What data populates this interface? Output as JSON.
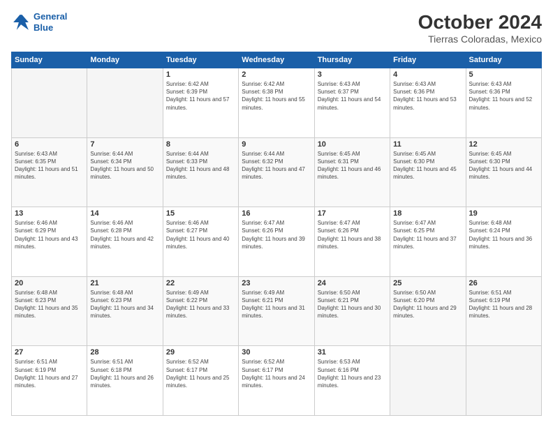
{
  "logo": {
    "line1": "General",
    "line2": "Blue"
  },
  "title": "October 2024",
  "subtitle": "Tierras Coloradas, Mexico",
  "headers": [
    "Sunday",
    "Monday",
    "Tuesday",
    "Wednesday",
    "Thursday",
    "Friday",
    "Saturday"
  ],
  "weeks": [
    [
      {
        "day": "",
        "empty": true
      },
      {
        "day": "",
        "empty": true
      },
      {
        "day": "1",
        "sunrise": "6:42 AM",
        "sunset": "6:39 PM",
        "daylight": "11 hours and 57 minutes."
      },
      {
        "day": "2",
        "sunrise": "6:42 AM",
        "sunset": "6:38 PM",
        "daylight": "11 hours and 55 minutes."
      },
      {
        "day": "3",
        "sunrise": "6:43 AM",
        "sunset": "6:37 PM",
        "daylight": "11 hours and 54 minutes."
      },
      {
        "day": "4",
        "sunrise": "6:43 AM",
        "sunset": "6:36 PM",
        "daylight": "11 hours and 53 minutes."
      },
      {
        "day": "5",
        "sunrise": "6:43 AM",
        "sunset": "6:36 PM",
        "daylight": "11 hours and 52 minutes."
      }
    ],
    [
      {
        "day": "6",
        "sunrise": "6:43 AM",
        "sunset": "6:35 PM",
        "daylight": "11 hours and 51 minutes."
      },
      {
        "day": "7",
        "sunrise": "6:44 AM",
        "sunset": "6:34 PM",
        "daylight": "11 hours and 50 minutes."
      },
      {
        "day": "8",
        "sunrise": "6:44 AM",
        "sunset": "6:33 PM",
        "daylight": "11 hours and 48 minutes."
      },
      {
        "day": "9",
        "sunrise": "6:44 AM",
        "sunset": "6:32 PM",
        "daylight": "11 hours and 47 minutes."
      },
      {
        "day": "10",
        "sunrise": "6:45 AM",
        "sunset": "6:31 PM",
        "daylight": "11 hours and 46 minutes."
      },
      {
        "day": "11",
        "sunrise": "6:45 AM",
        "sunset": "6:30 PM",
        "daylight": "11 hours and 45 minutes."
      },
      {
        "day": "12",
        "sunrise": "6:45 AM",
        "sunset": "6:30 PM",
        "daylight": "11 hours and 44 minutes."
      }
    ],
    [
      {
        "day": "13",
        "sunrise": "6:46 AM",
        "sunset": "6:29 PM",
        "daylight": "11 hours and 43 minutes."
      },
      {
        "day": "14",
        "sunrise": "6:46 AM",
        "sunset": "6:28 PM",
        "daylight": "11 hours and 42 minutes."
      },
      {
        "day": "15",
        "sunrise": "6:46 AM",
        "sunset": "6:27 PM",
        "daylight": "11 hours and 40 minutes."
      },
      {
        "day": "16",
        "sunrise": "6:47 AM",
        "sunset": "6:26 PM",
        "daylight": "11 hours and 39 minutes."
      },
      {
        "day": "17",
        "sunrise": "6:47 AM",
        "sunset": "6:26 PM",
        "daylight": "11 hours and 38 minutes."
      },
      {
        "day": "18",
        "sunrise": "6:47 AM",
        "sunset": "6:25 PM",
        "daylight": "11 hours and 37 minutes."
      },
      {
        "day": "19",
        "sunrise": "6:48 AM",
        "sunset": "6:24 PM",
        "daylight": "11 hours and 36 minutes."
      }
    ],
    [
      {
        "day": "20",
        "sunrise": "6:48 AM",
        "sunset": "6:23 PM",
        "daylight": "11 hours and 35 minutes."
      },
      {
        "day": "21",
        "sunrise": "6:48 AM",
        "sunset": "6:23 PM",
        "daylight": "11 hours and 34 minutes."
      },
      {
        "day": "22",
        "sunrise": "6:49 AM",
        "sunset": "6:22 PM",
        "daylight": "11 hours and 33 minutes."
      },
      {
        "day": "23",
        "sunrise": "6:49 AM",
        "sunset": "6:21 PM",
        "daylight": "11 hours and 31 minutes."
      },
      {
        "day": "24",
        "sunrise": "6:50 AM",
        "sunset": "6:21 PM",
        "daylight": "11 hours and 30 minutes."
      },
      {
        "day": "25",
        "sunrise": "6:50 AM",
        "sunset": "6:20 PM",
        "daylight": "11 hours and 29 minutes."
      },
      {
        "day": "26",
        "sunrise": "6:51 AM",
        "sunset": "6:19 PM",
        "daylight": "11 hours and 28 minutes."
      }
    ],
    [
      {
        "day": "27",
        "sunrise": "6:51 AM",
        "sunset": "6:19 PM",
        "daylight": "11 hours and 27 minutes."
      },
      {
        "day": "28",
        "sunrise": "6:51 AM",
        "sunset": "6:18 PM",
        "daylight": "11 hours and 26 minutes."
      },
      {
        "day": "29",
        "sunrise": "6:52 AM",
        "sunset": "6:17 PM",
        "daylight": "11 hours and 25 minutes."
      },
      {
        "day": "30",
        "sunrise": "6:52 AM",
        "sunset": "6:17 PM",
        "daylight": "11 hours and 24 minutes."
      },
      {
        "day": "31",
        "sunrise": "6:53 AM",
        "sunset": "6:16 PM",
        "daylight": "11 hours and 23 minutes."
      },
      {
        "day": "",
        "empty": true
      },
      {
        "day": "",
        "empty": true
      }
    ]
  ]
}
